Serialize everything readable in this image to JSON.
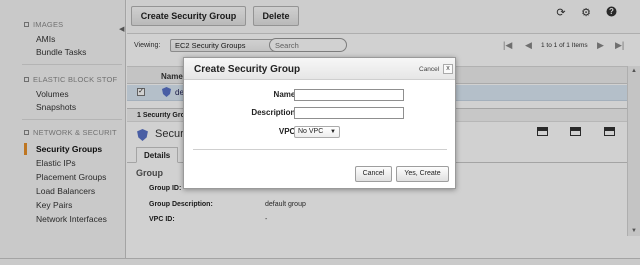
{
  "sidebar": {
    "sections": [
      {
        "title": "IMAGES",
        "items": [
          {
            "label": "AMIs",
            "active": false
          },
          {
            "label": "Bundle Tasks",
            "active": false
          }
        ]
      },
      {
        "title": "ELASTIC BLOCK STOF",
        "items": [
          {
            "label": "Volumes",
            "active": false
          },
          {
            "label": "Snapshots",
            "active": false
          }
        ]
      },
      {
        "title": "NETWORK & SECURIT",
        "items": [
          {
            "label": "Security Groups",
            "active": true
          },
          {
            "label": "Elastic IPs",
            "active": false
          },
          {
            "label": "Placement Groups",
            "active": false
          },
          {
            "label": "Load Balancers",
            "active": false
          },
          {
            "label": "Key Pairs",
            "active": false
          },
          {
            "label": "Network Interfaces",
            "active": false
          }
        ]
      }
    ],
    "active_color": "#e8902a"
  },
  "toolbar": {
    "create_label": "Create Security Group",
    "delete_label": "Delete",
    "icons": [
      "refresh-icon",
      "gear-icon",
      "help-icon"
    ]
  },
  "filter": {
    "viewing_label": "Viewing:",
    "viewing_value": "EC2 Security Groups",
    "search_placeholder": "Search",
    "pagination": "1 to 1 of 1 Items"
  },
  "table": {
    "columns": [
      "Name"
    ],
    "rows": [
      {
        "name": "default",
        "checked": true
      }
    ]
  },
  "details": {
    "selected_count": "1 Security Group selected",
    "title": "Security Group: default",
    "tab": "Details",
    "group_heading": "Group",
    "fields": [
      {
        "label": "Group ID:",
        "value": ""
      },
      {
        "label": "Group Description:",
        "value": "default group"
      },
      {
        "label": "VPC ID:",
        "value": "-"
      }
    ]
  },
  "modal": {
    "title": "Create Security Group",
    "cancel_link": "Cancel",
    "close_glyph": "x",
    "name_label": "Name:",
    "name_value": "",
    "description_label": "Description:",
    "description_value": "",
    "vpc_label": "VPC:",
    "vpc_value": "No VPC",
    "cancel_button": "Cancel",
    "create_button": "Yes, Create"
  }
}
